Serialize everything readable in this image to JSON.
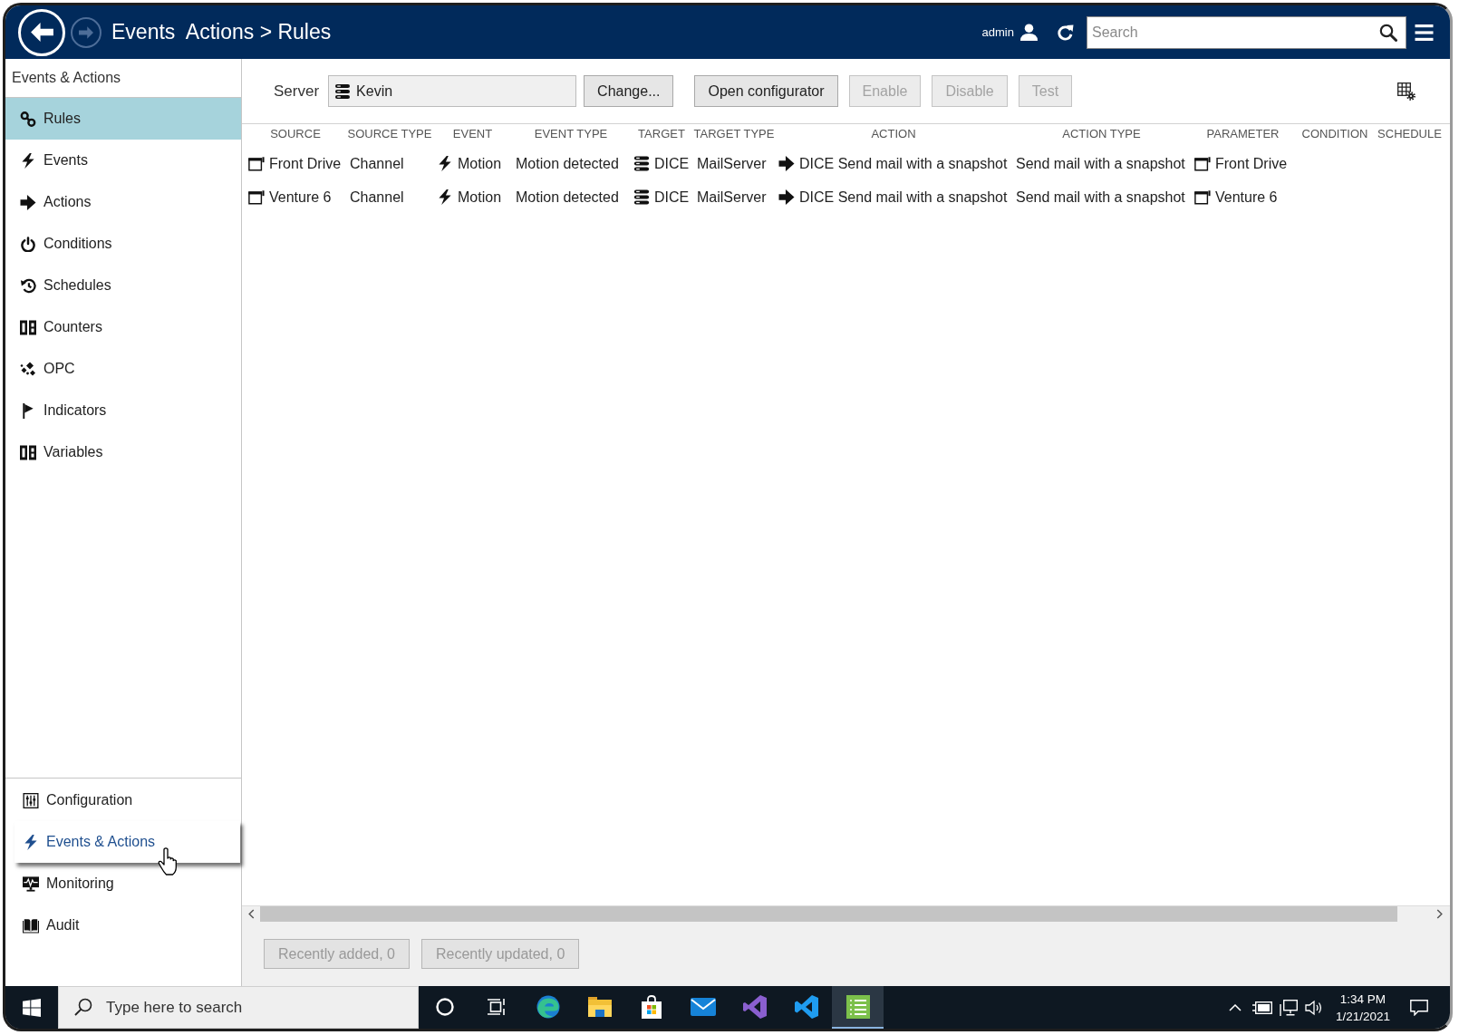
{
  "header": {
    "title": "Events  Actions > Rules",
    "user": "admin",
    "search": {
      "placeholder": "Search"
    }
  },
  "sidebar": {
    "title": "Events & Actions",
    "items": [
      {
        "label": "Rules",
        "kind": "rules",
        "selected": true
      },
      {
        "label": "Events",
        "kind": "events",
        "selected": false
      },
      {
        "label": "Actions",
        "kind": "actions",
        "selected": false
      },
      {
        "label": "Conditions",
        "kind": "conditions",
        "selected": false
      },
      {
        "label": "Schedules",
        "kind": "schedules",
        "selected": false
      },
      {
        "label": "Counters",
        "kind": "counters",
        "selected": false
      },
      {
        "label": "OPC",
        "kind": "opc",
        "selected": false
      },
      {
        "label": "Indicators",
        "kind": "indicators",
        "selected": false
      },
      {
        "label": "Variables",
        "kind": "variables",
        "selected": false
      }
    ],
    "sections": [
      {
        "label": "Configuration",
        "kind": "configuration",
        "selected": false
      },
      {
        "label": "Events & Actions",
        "kind": "events",
        "selected": true
      },
      {
        "label": "Monitoring",
        "kind": "monitoring",
        "selected": false
      },
      {
        "label": "Audit",
        "kind": "audit",
        "selected": false
      }
    ]
  },
  "toolbar": {
    "server_label": "Server",
    "server": {
      "value": "Kevin"
    },
    "buttons": [
      {
        "label": "Change...",
        "disabled": false
      },
      {
        "label": "Open configurator",
        "disabled": false
      },
      {
        "label": "Enable",
        "disabled": true
      },
      {
        "label": "Disable",
        "disabled": true
      },
      {
        "label": "Test",
        "disabled": true
      }
    ]
  },
  "table": {
    "columns": [
      "SOURCE",
      "SOURCE TYPE",
      "EVENT",
      "EVENT TYPE",
      "TARGET",
      "TARGET TYPE",
      "ACTION",
      "ACTION TYPE",
      "PARAMETER",
      "CONDITION",
      "SCHEDULE"
    ],
    "rows": [
      {
        "cells": [
          {
            "text": "Front Drive",
            "kind": "channel"
          },
          {
            "text": "Channel",
            "kind": "plain"
          },
          {
            "text": "Motion",
            "kind": "event"
          },
          {
            "text": "Motion detected",
            "kind": "plain"
          },
          {
            "text": "DICE",
            "kind": "server"
          },
          {
            "text": "MailServer",
            "kind": "plain"
          },
          {
            "text": "DICE Send mail with a snapshot",
            "kind": "action"
          },
          {
            "text": "Send mail with a snapshot",
            "kind": "plain"
          },
          {
            "text": "Front Drive",
            "kind": "channel"
          }
        ]
      },
      {
        "cells": [
          {
            "text": "Venture 6",
            "kind": "channel"
          },
          {
            "text": "Channel",
            "kind": "plain"
          },
          {
            "text": "Motion",
            "kind": "event"
          },
          {
            "text": "Motion detected",
            "kind": "plain"
          },
          {
            "text": "DICE",
            "kind": "server"
          },
          {
            "text": "MailServer",
            "kind": "plain"
          },
          {
            "text": "DICE Send mail with a snapshot",
            "kind": "action"
          },
          {
            "text": "Send mail with a snapshot",
            "kind": "plain"
          },
          {
            "text": "Venture 6",
            "kind": "channel"
          }
        ]
      }
    ]
  },
  "footer": {
    "buttons": [
      {
        "label": "Recently added, 0",
        "disabled": true
      },
      {
        "label": "Recently updated, 0",
        "disabled": true
      }
    ]
  },
  "taskbar": {
    "search": {
      "placeholder": "Type here to search"
    },
    "apps": [
      {
        "kind": "ring",
        "active": false
      },
      {
        "kind": "taskview",
        "active": false
      },
      {
        "kind": "swirl",
        "active": false
      },
      {
        "kind": "folder",
        "active": false
      },
      {
        "kind": "bag",
        "active": false
      },
      {
        "kind": "envelope",
        "active": false
      },
      {
        "kind": "ribbon",
        "active": false
      },
      {
        "kind": "fold",
        "active": false
      },
      {
        "kind": "sheet",
        "active": true
      }
    ],
    "time": "1:34 PM",
    "date": "1/21/2021"
  }
}
